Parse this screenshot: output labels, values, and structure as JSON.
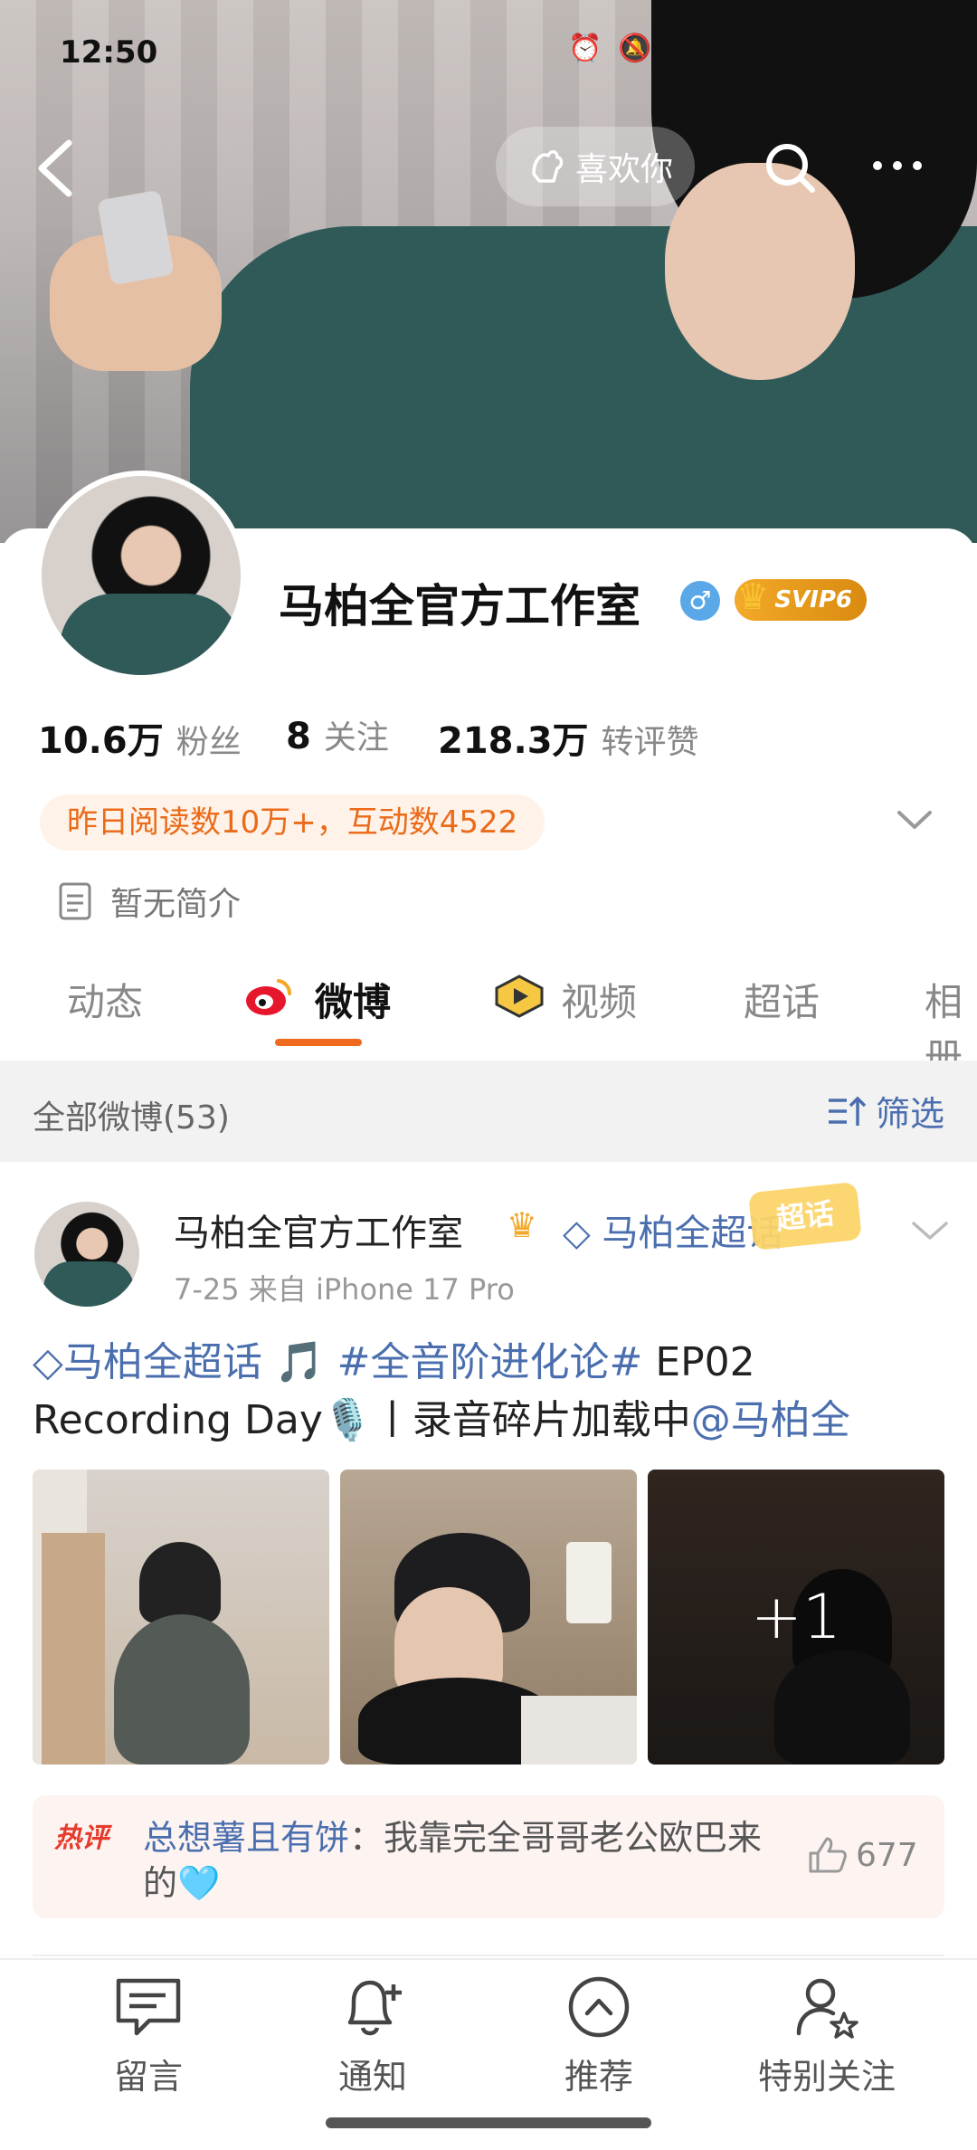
{
  "status_bar": {
    "time": "12:50"
  },
  "header": {
    "like_label": "喜欢你"
  },
  "profile": {
    "name": "马柏全官方工作室",
    "gender_symbol": "♂",
    "vip_badge": "SVIP6",
    "stats": [
      {
        "value": "10.6万",
        "label": "粉丝"
      },
      {
        "value": "8",
        "label": "关注"
      },
      {
        "value": "218.3万",
        "label": "转评赞"
      }
    ],
    "read_stats": "昨日阅读数10万+，互动数4522",
    "bio": "暂无简介"
  },
  "tabs": [
    "动态",
    "微博",
    "视频",
    "超话",
    "相册"
  ],
  "filter": {
    "label": "全部微博(53)",
    "button": "筛选"
  },
  "post": {
    "author": "马柏全官方工作室",
    "topic": "马柏全超话",
    "topic_badge": "超话",
    "meta": "7-25  来自 iPhone 17 Pro",
    "body_topic": "马柏全超话",
    "body_hashtag": " 🎵 #全音阶进化论#",
    "body_text": " EP02 Recording Day🎙️丨录音碎片加载中",
    "body_mention": "@马柏全",
    "more_photos": "+1",
    "hot_comment": {
      "tag": "热评",
      "user": "总想薯且有饼",
      "text": "：我靠完全哥哥老公欧巴来的🩵",
      "likes": "677"
    }
  },
  "bottom_nav": [
    {
      "label": "留言",
      "icon": "message-icon"
    },
    {
      "label": "通知",
      "icon": "bell-icon"
    },
    {
      "label": "推荐",
      "icon": "recommend-icon"
    },
    {
      "label": "特别关注",
      "icon": "special-follow-icon"
    }
  ]
}
